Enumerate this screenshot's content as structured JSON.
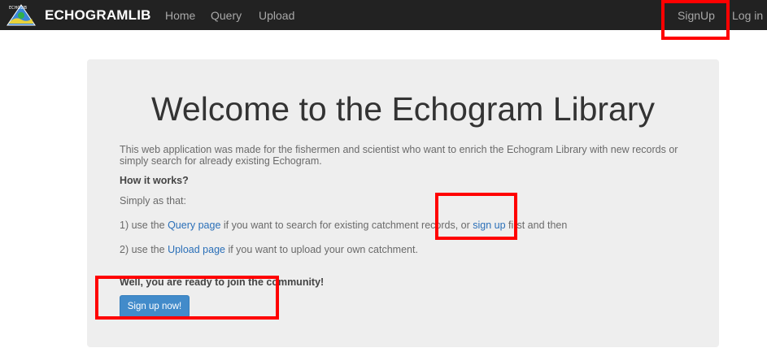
{
  "navbar": {
    "brand": "ECHOGRAMLIB",
    "logo_text": "ECHOLIB",
    "links": {
      "home": "Home",
      "query": "Query",
      "upload": "Upload"
    },
    "signup": "SignUp",
    "login": "Log in"
  },
  "main": {
    "title": "Welcome to the Echogram Library",
    "intro": "This web application was made for the fishermen and scientist who want to enrich the Echogram Library with new records or simply search for already existing Echogram.",
    "how_it_works": "How it works?",
    "simply": "Simply as that:",
    "step1": {
      "prefix": "1) use the ",
      "query_link": "Query page",
      "middle": " if you want to search for existing catchment records, or ",
      "signup_link": "sign up",
      "suffix": " first and then"
    },
    "step2": {
      "prefix": "2) use the ",
      "upload_link": "Upload page",
      "suffix": " if you want to upload your own catchment."
    },
    "ready": "Well, you are ready to join the community!",
    "signup_button": "Sign up now!"
  },
  "colors": {
    "navbar_bg": "#222222",
    "link": "#2a6fb8",
    "button": "#428bca",
    "highlight": "#ff0000"
  }
}
